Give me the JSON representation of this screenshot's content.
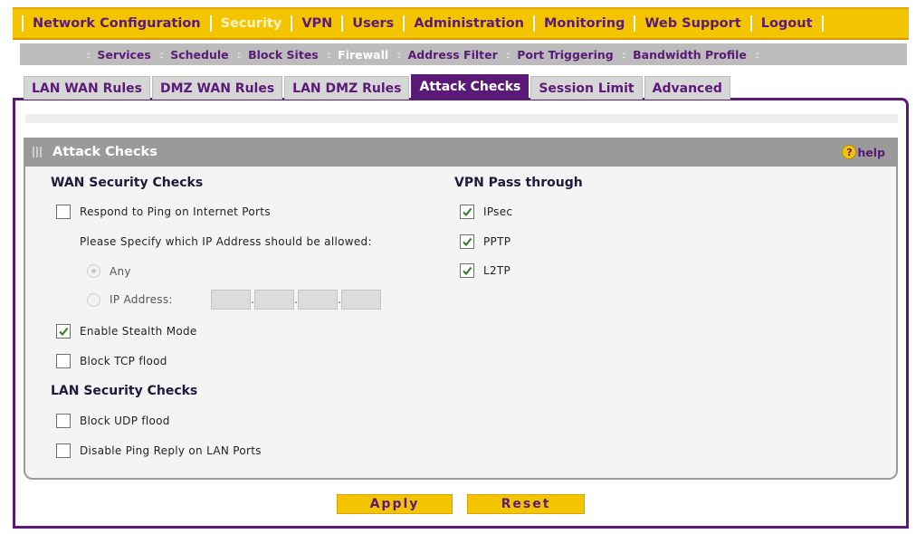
{
  "topnav": {
    "items": [
      {
        "label": "Network Configuration",
        "active": false
      },
      {
        "label": "Security",
        "active": true
      },
      {
        "label": "VPN",
        "active": false
      },
      {
        "label": "Users",
        "active": false
      },
      {
        "label": "Administration",
        "active": false
      },
      {
        "label": "Monitoring",
        "active": false
      },
      {
        "label": "Web Support",
        "active": false
      },
      {
        "label": "Logout",
        "active": false
      }
    ]
  },
  "subnav": {
    "items": [
      {
        "label": "Services",
        "active": false
      },
      {
        "label": "Schedule",
        "active": false
      },
      {
        "label": "Block Sites",
        "active": false
      },
      {
        "label": "Firewall",
        "active": true
      },
      {
        "label": "Address Filter",
        "active": false
      },
      {
        "label": "Port Triggering",
        "active": false
      },
      {
        "label": "Bandwidth Profile",
        "active": false
      }
    ]
  },
  "tabs": [
    {
      "label": "LAN WAN Rules",
      "active": false
    },
    {
      "label": "DMZ WAN Rules",
      "active": false
    },
    {
      "label": "LAN DMZ Rules",
      "active": false
    },
    {
      "label": "Attack Checks",
      "active": true
    },
    {
      "label": "Session Limit",
      "active": false
    },
    {
      "label": "Advanced",
      "active": false
    }
  ],
  "panel": {
    "title": "Attack Checks",
    "help_label": "help",
    "help_icon": "question-circle-icon"
  },
  "wan": {
    "heading": "WAN Security Checks",
    "respond_ping": {
      "label": "Respond to Ping on Internet Ports",
      "checked": false
    },
    "allow_prompt": "Please Specify which IP Address should be allowed:",
    "radio_any": {
      "label": "Any",
      "selected": true
    },
    "radio_ip": {
      "label": "IP Address:",
      "selected": false
    },
    "ip_octets": [
      "",
      "",
      "",
      ""
    ],
    "stealth": {
      "label": "Enable Stealth Mode",
      "checked": true
    },
    "tcp_flood": {
      "label": "Block TCP flood",
      "checked": false
    }
  },
  "lan": {
    "heading": "LAN Security Checks",
    "udp_flood": {
      "label": "Block UDP flood",
      "checked": false
    },
    "disable_ping": {
      "label": "Disable Ping Reply on LAN Ports",
      "checked": false
    }
  },
  "vpn": {
    "heading": "VPN Pass through",
    "ipsec": {
      "label": "IPsec",
      "checked": true
    },
    "pptp": {
      "label": "PPTP",
      "checked": true
    },
    "l2tp": {
      "label": "L2TP",
      "checked": true
    }
  },
  "buttons": {
    "apply": "Apply",
    "reset": "Reset"
  },
  "colors": {
    "accent_yellow": "#f5c400",
    "brand_purple": "#5a1a78",
    "panel_grey": "#9a9a9a"
  }
}
